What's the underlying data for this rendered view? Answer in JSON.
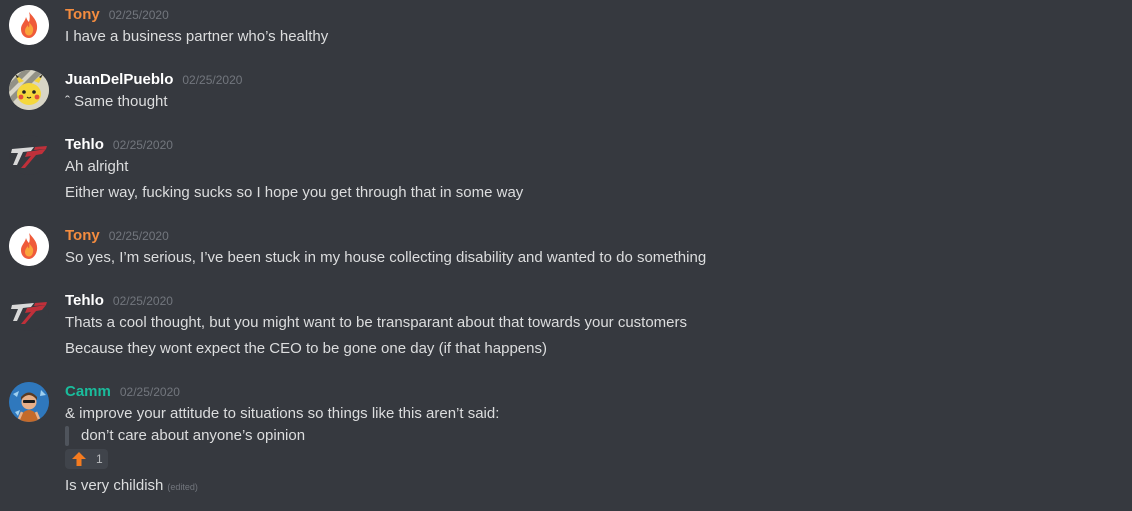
{
  "messages": [
    {
      "author": "Tony",
      "author_color": "#f48c3f",
      "avatar_icon": "fire-avatar-icon",
      "timestamp": "02/25/2020",
      "lines": [
        "I have a business partner who’s healthy"
      ]
    },
    {
      "author": "JuanDelPueblo",
      "author_color": "#ffffff",
      "avatar_icon": "pikachu-avatar-icon",
      "timestamp": "02/25/2020",
      "lines": [
        "ˆ Same thought"
      ]
    },
    {
      "author": "Tehlo",
      "author_color": "#ffffff",
      "avatar_icon": "tehlo-logo-avatar-icon",
      "timestamp": "02/25/2020",
      "lines": [
        "Ah alright",
        "Either way, fucking sucks so I hope you get through that in some way"
      ]
    },
    {
      "author": "Tony",
      "author_color": "#f48c3f",
      "avatar_icon": "fire-avatar-icon",
      "timestamp": "02/25/2020",
      "lines": [
        "So yes, I’m serious, I’ve been stuck in my house collecting disability and wanted to do something"
      ]
    },
    {
      "author": "Tehlo",
      "author_color": "#ffffff",
      "avatar_icon": "tehlo-logo-avatar-icon",
      "timestamp": "02/25/2020",
      "lines": [
        "Thats a cool thought, but you might want to be transparant about that towards your customers",
        "Because they wont expect the CEO to be gone one day (if that happens)"
      ]
    },
    {
      "author": "Camm",
      "author_color": "#1abc9c",
      "avatar_icon": "camm-avatar-icon",
      "timestamp": "02/25/2020",
      "lines": [
        "& improve your attitude to situations so things like this aren’t said:"
      ],
      "quote": "don’t care about anyone’s opinion",
      "reaction": {
        "icon": "up-arrow-emoji-icon",
        "count": "1"
      },
      "followup": "Is very childish",
      "followup_edited": "(edited)"
    }
  ]
}
